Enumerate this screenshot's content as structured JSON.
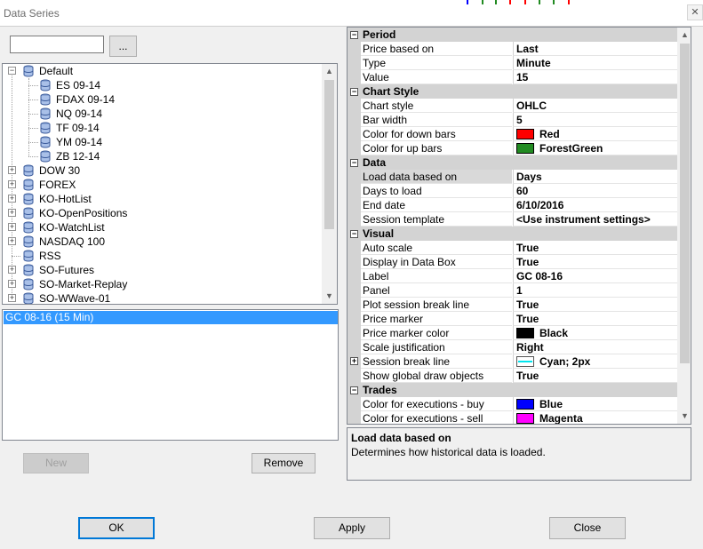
{
  "window": {
    "title": "Data Series",
    "close_glyph": "✕"
  },
  "search": {
    "value": "",
    "browse_label": "..."
  },
  "tree": [
    {
      "label": "Default",
      "expanded": true,
      "children": [
        "ES 09-14",
        "FDAX 09-14",
        "NQ 09-14",
        "TF 09-14",
        "YM 09-14",
        "ZB 12-14"
      ]
    },
    {
      "label": "DOW 30",
      "expanded": false
    },
    {
      "label": "FOREX",
      "expanded": false
    },
    {
      "label": "KO-HotList",
      "expanded": false
    },
    {
      "label": "KO-OpenPositions",
      "expanded": false
    },
    {
      "label": "KO-WatchList",
      "expanded": false
    },
    {
      "label": "NASDAQ 100",
      "expanded": false
    },
    {
      "label": "RSS",
      "expanded": null
    },
    {
      "label": "SO-Futures",
      "expanded": false
    },
    {
      "label": "SO-Market-Replay",
      "expanded": false
    },
    {
      "label": "SO-WWave-01",
      "expanded": false
    }
  ],
  "series": {
    "items": [
      "GC 08-16 (15 Min)"
    ],
    "selected": "GC 08-16 (15 Min)"
  },
  "buttons": {
    "new": "New",
    "remove": "Remove",
    "ok": "OK",
    "apply": "Apply",
    "close": "Close"
  },
  "properties": [
    {
      "category": "Period",
      "items": [
        {
          "name": "Price based on",
          "value": "Last"
        },
        {
          "name": "Type",
          "value": "Minute"
        },
        {
          "name": "Value",
          "value": "15"
        }
      ]
    },
    {
      "category": "Chart Style",
      "items": [
        {
          "name": "Chart style",
          "value": "OHLC"
        },
        {
          "name": "Bar width",
          "value": "5"
        },
        {
          "name": "Color for down bars",
          "value": "Red",
          "color": "#ff0000"
        },
        {
          "name": "Color for up bars",
          "value": "ForestGreen",
          "color": "#228b22"
        }
      ]
    },
    {
      "category": "Data",
      "items": [
        {
          "name": "Load data based on",
          "value": "Days",
          "selected": true
        },
        {
          "name": "Days to load",
          "value": "60"
        },
        {
          "name": "End date",
          "value": "6/10/2016"
        },
        {
          "name": "Session template",
          "value": "<Use instrument settings>"
        }
      ]
    },
    {
      "category": "Visual",
      "items": [
        {
          "name": "Auto scale",
          "value": "True"
        },
        {
          "name": "Display in Data Box",
          "value": "True"
        },
        {
          "name": "Label",
          "value": "GC 08-16"
        },
        {
          "name": "Panel",
          "value": "1"
        },
        {
          "name": "Plot session break line",
          "value": "True"
        },
        {
          "name": "Price marker",
          "value": "True"
        },
        {
          "name": "Price marker color",
          "value": "Black",
          "color": "#000000"
        },
        {
          "name": "Scale justification",
          "value": "Right"
        },
        {
          "name": "Session break line",
          "value": "Cyan; 2px",
          "swatch": "line",
          "expandable": true
        },
        {
          "name": "Show global draw objects",
          "value": "True"
        }
      ]
    },
    {
      "category": "Trades",
      "items": [
        {
          "name": "Color for executions - buy",
          "value": "Blue",
          "color": "#0000ff"
        },
        {
          "name": "Color for executions - sell",
          "value": "Magenta",
          "color": "#ff00ff"
        }
      ]
    }
  ],
  "help": {
    "title": "Load data based on",
    "description": "Determines how historical data is loaded."
  },
  "icons": {
    "expand": "⊞",
    "collapse": "⊟",
    "plus": "+",
    "minus": "−",
    "scroll_up": "▲",
    "scroll_down": "▼",
    "database": "database-icon"
  },
  "colors": {
    "selection": "#3399ff",
    "category_bg": "#d3d3d3",
    "accent": "#0078d7"
  }
}
